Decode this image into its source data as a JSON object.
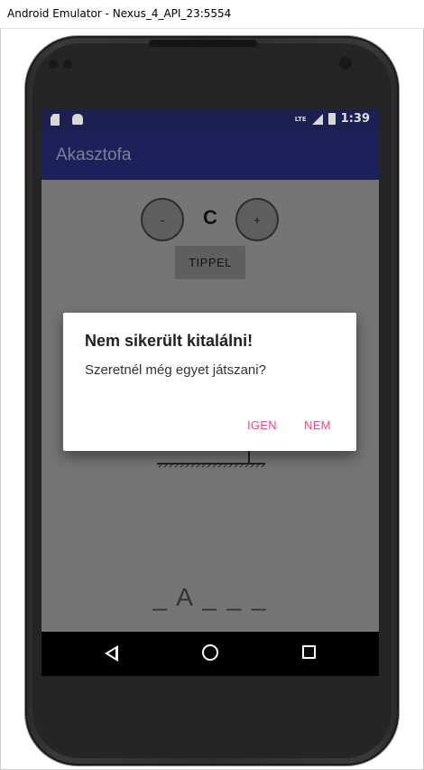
{
  "window": {
    "title": "Android Emulator - Nexus_4_API_23:5554"
  },
  "status_bar": {
    "network": "LTE",
    "time": "1:39"
  },
  "app": {
    "title": "Akasztofa"
  },
  "game": {
    "minus_label": "-",
    "plus_label": "+",
    "current_letter": "C",
    "guess_button": "TIPPEL",
    "word_display": "_ A _ _ _"
  },
  "dialog": {
    "title": "Nem sikerült kitalálni!",
    "message": "Szeretnél még egyet játszani?",
    "positive": "IGEN",
    "negative": "NEM"
  },
  "colors": {
    "app_bar": "#1c2259",
    "status_bar": "#1b2050",
    "accent": "#ff4081",
    "scrim": "#757575"
  }
}
